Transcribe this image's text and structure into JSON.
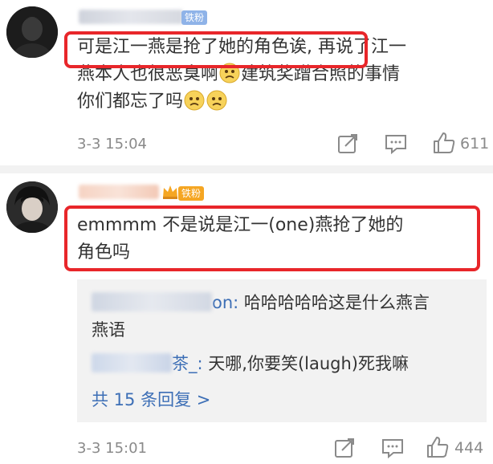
{
  "comments": [
    {
      "badge": "铁粉",
      "text_highlight": "可是江一燕是抢了她的角色诶,",
      "text_rest_1": "再说了江一",
      "text_line2_a": "燕本人也很恶臭啊",
      "text_line2_b": "建筑奖蹭合照的事情",
      "text_line3": "你们都忘了吗",
      "time": "3-3 15:04",
      "likes": "611"
    },
    {
      "badge": "铁粉",
      "text_line1": "emmmm 不是说是江一(one)燕抢了她的",
      "text_line2": "角色吗",
      "time": "3-3 15:01",
      "likes": "444",
      "replies": [
        {
          "name_tail": "on:",
          "text_a": "哈哈哈哈哈这是什么燕言",
          "text_b": "燕语"
        },
        {
          "name_tail": "茶_:",
          "text_a": "天哪,你要笑(laugh)死我嘛"
        }
      ],
      "more": "共 15 条回复 >"
    }
  ],
  "colors": {
    "highlight_border": "#e8262a",
    "link": "#3d6fb6",
    "badge": "#f5a623"
  },
  "icons": [
    "share-icon",
    "comment-icon",
    "like-icon",
    "sad-emoji-icon"
  ]
}
